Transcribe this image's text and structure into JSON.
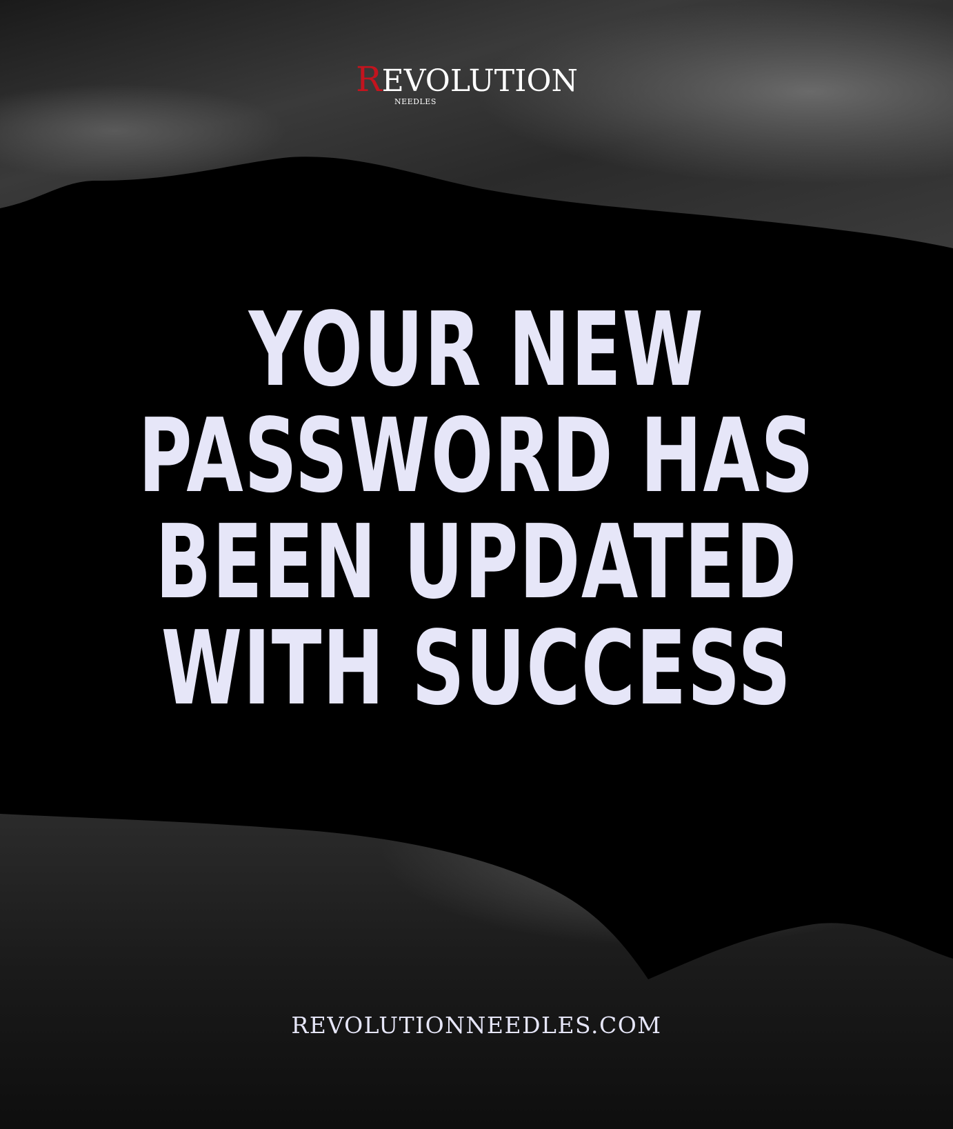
{
  "brand": {
    "logo_main": "EVOLUTION",
    "logo_initial": "R",
    "logo_sub": "NEEDLES",
    "accent_color": "#c3141e"
  },
  "message": {
    "lines": [
      "YOUR NEW",
      "PASSWORD HAS",
      "BEEN UPDATED",
      "WITH SUCCESS"
    ],
    "text_color": "#e6e6f8"
  },
  "footer": {
    "url_text": "REVOLUTIONNEEDLES.COM"
  }
}
